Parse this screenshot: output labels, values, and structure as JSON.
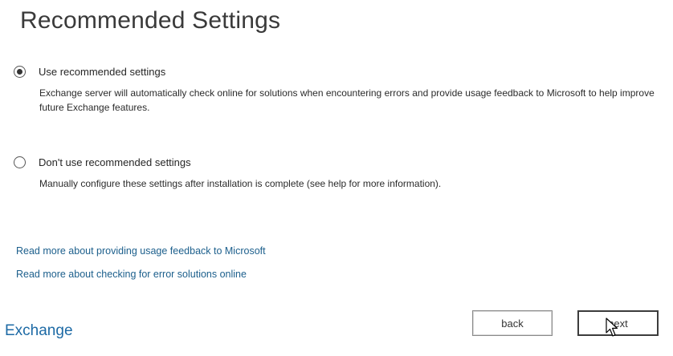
{
  "page": {
    "title": "Recommended Settings"
  },
  "options": [
    {
      "label": "Use recommended settings",
      "description": "Exchange server will automatically check online for solutions when encountering errors and provide usage feedback to Microsoft to help improve future Exchange features.",
      "selected": true
    },
    {
      "label": "Don't use recommended settings",
      "description": "Manually configure these settings after installation is complete (see help for more information).",
      "selected": false
    }
  ],
  "links": [
    "Read more about providing usage feedback to Microsoft",
    "Read more about checking for error solutions online"
  ],
  "footer": {
    "brand": "Exchange",
    "back_label": "back",
    "next_label": "next"
  },
  "colors": {
    "link": "#1c5f8c",
    "brand": "#1d6aa5"
  },
  "icons": {
    "cursor": "mouse-pointer-icon"
  }
}
